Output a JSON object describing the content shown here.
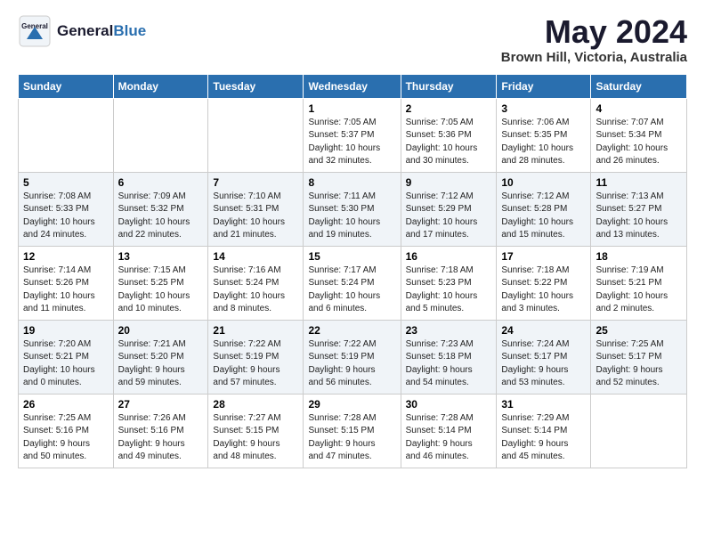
{
  "header": {
    "logo_general": "General",
    "logo_blue": "Blue",
    "month": "May 2024",
    "location": "Brown Hill, Victoria, Australia"
  },
  "weekdays": [
    "Sunday",
    "Monday",
    "Tuesday",
    "Wednesday",
    "Thursday",
    "Friday",
    "Saturday"
  ],
  "weeks": [
    [
      {
        "day": "",
        "info": ""
      },
      {
        "day": "",
        "info": ""
      },
      {
        "day": "",
        "info": ""
      },
      {
        "day": "1",
        "info": "Sunrise: 7:05 AM\nSunset: 5:37 PM\nDaylight: 10 hours\nand 32 minutes."
      },
      {
        "day": "2",
        "info": "Sunrise: 7:05 AM\nSunset: 5:36 PM\nDaylight: 10 hours\nand 30 minutes."
      },
      {
        "day": "3",
        "info": "Sunrise: 7:06 AM\nSunset: 5:35 PM\nDaylight: 10 hours\nand 28 minutes."
      },
      {
        "day": "4",
        "info": "Sunrise: 7:07 AM\nSunset: 5:34 PM\nDaylight: 10 hours\nand 26 minutes."
      }
    ],
    [
      {
        "day": "5",
        "info": "Sunrise: 7:08 AM\nSunset: 5:33 PM\nDaylight: 10 hours\nand 24 minutes."
      },
      {
        "day": "6",
        "info": "Sunrise: 7:09 AM\nSunset: 5:32 PM\nDaylight: 10 hours\nand 22 minutes."
      },
      {
        "day": "7",
        "info": "Sunrise: 7:10 AM\nSunset: 5:31 PM\nDaylight: 10 hours\nand 21 minutes."
      },
      {
        "day": "8",
        "info": "Sunrise: 7:11 AM\nSunset: 5:30 PM\nDaylight: 10 hours\nand 19 minutes."
      },
      {
        "day": "9",
        "info": "Sunrise: 7:12 AM\nSunset: 5:29 PM\nDaylight: 10 hours\nand 17 minutes."
      },
      {
        "day": "10",
        "info": "Sunrise: 7:12 AM\nSunset: 5:28 PM\nDaylight: 10 hours\nand 15 minutes."
      },
      {
        "day": "11",
        "info": "Sunrise: 7:13 AM\nSunset: 5:27 PM\nDaylight: 10 hours\nand 13 minutes."
      }
    ],
    [
      {
        "day": "12",
        "info": "Sunrise: 7:14 AM\nSunset: 5:26 PM\nDaylight: 10 hours\nand 11 minutes."
      },
      {
        "day": "13",
        "info": "Sunrise: 7:15 AM\nSunset: 5:25 PM\nDaylight: 10 hours\nand 10 minutes."
      },
      {
        "day": "14",
        "info": "Sunrise: 7:16 AM\nSunset: 5:24 PM\nDaylight: 10 hours\nand 8 minutes."
      },
      {
        "day": "15",
        "info": "Sunrise: 7:17 AM\nSunset: 5:24 PM\nDaylight: 10 hours\nand 6 minutes."
      },
      {
        "day": "16",
        "info": "Sunrise: 7:18 AM\nSunset: 5:23 PM\nDaylight: 10 hours\nand 5 minutes."
      },
      {
        "day": "17",
        "info": "Sunrise: 7:18 AM\nSunset: 5:22 PM\nDaylight: 10 hours\nand 3 minutes."
      },
      {
        "day": "18",
        "info": "Sunrise: 7:19 AM\nSunset: 5:21 PM\nDaylight: 10 hours\nand 2 minutes."
      }
    ],
    [
      {
        "day": "19",
        "info": "Sunrise: 7:20 AM\nSunset: 5:21 PM\nDaylight: 10 hours\nand 0 minutes."
      },
      {
        "day": "20",
        "info": "Sunrise: 7:21 AM\nSunset: 5:20 PM\nDaylight: 9 hours\nand 59 minutes."
      },
      {
        "day": "21",
        "info": "Sunrise: 7:22 AM\nSunset: 5:19 PM\nDaylight: 9 hours\nand 57 minutes."
      },
      {
        "day": "22",
        "info": "Sunrise: 7:22 AM\nSunset: 5:19 PM\nDaylight: 9 hours\nand 56 minutes."
      },
      {
        "day": "23",
        "info": "Sunrise: 7:23 AM\nSunset: 5:18 PM\nDaylight: 9 hours\nand 54 minutes."
      },
      {
        "day": "24",
        "info": "Sunrise: 7:24 AM\nSunset: 5:17 PM\nDaylight: 9 hours\nand 53 minutes."
      },
      {
        "day": "25",
        "info": "Sunrise: 7:25 AM\nSunset: 5:17 PM\nDaylight: 9 hours\nand 52 minutes."
      }
    ],
    [
      {
        "day": "26",
        "info": "Sunrise: 7:25 AM\nSunset: 5:16 PM\nDaylight: 9 hours\nand 50 minutes."
      },
      {
        "day": "27",
        "info": "Sunrise: 7:26 AM\nSunset: 5:16 PM\nDaylight: 9 hours\nand 49 minutes."
      },
      {
        "day": "28",
        "info": "Sunrise: 7:27 AM\nSunset: 5:15 PM\nDaylight: 9 hours\nand 48 minutes."
      },
      {
        "day": "29",
        "info": "Sunrise: 7:28 AM\nSunset: 5:15 PM\nDaylight: 9 hours\nand 47 minutes."
      },
      {
        "day": "30",
        "info": "Sunrise: 7:28 AM\nSunset: 5:14 PM\nDaylight: 9 hours\nand 46 minutes."
      },
      {
        "day": "31",
        "info": "Sunrise: 7:29 AM\nSunset: 5:14 PM\nDaylight: 9 hours\nand 45 minutes."
      },
      {
        "day": "",
        "info": ""
      }
    ]
  ]
}
